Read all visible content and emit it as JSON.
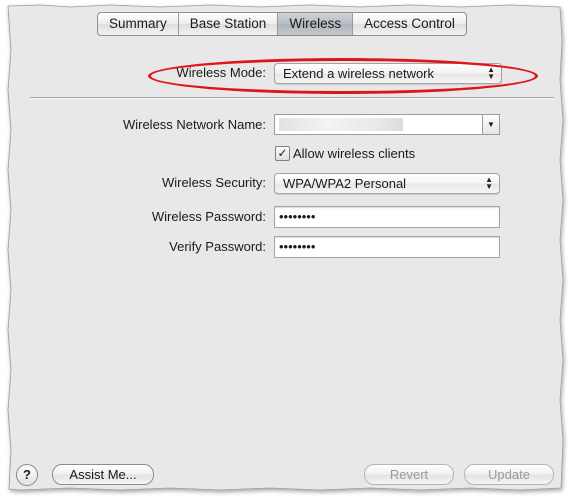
{
  "tabs": [
    {
      "label": "Summary"
    },
    {
      "label": "Base Station"
    },
    {
      "label": "Wireless",
      "active": true
    },
    {
      "label": "Access Control"
    }
  ],
  "wireless_mode": {
    "label": "Wireless Mode:",
    "value": "Extend a wireless network"
  },
  "network_name": {
    "label": "Wireless Network Name:",
    "value": ""
  },
  "allow_clients": {
    "label": "Allow wireless clients",
    "checked": true,
    "mark": "✓"
  },
  "security": {
    "label": "Wireless Security:",
    "value": "WPA/WPA2 Personal"
  },
  "password": {
    "label": "Wireless Password:",
    "value": "••••••••"
  },
  "verify": {
    "label": "Verify Password:",
    "value": "••••••••"
  },
  "footer": {
    "help": "?",
    "assist": "Assist Me...",
    "revert": "Revert",
    "update": "Update"
  },
  "colors": {
    "highlight_ring": "#e0141b",
    "panel": "#e8e8e8"
  }
}
